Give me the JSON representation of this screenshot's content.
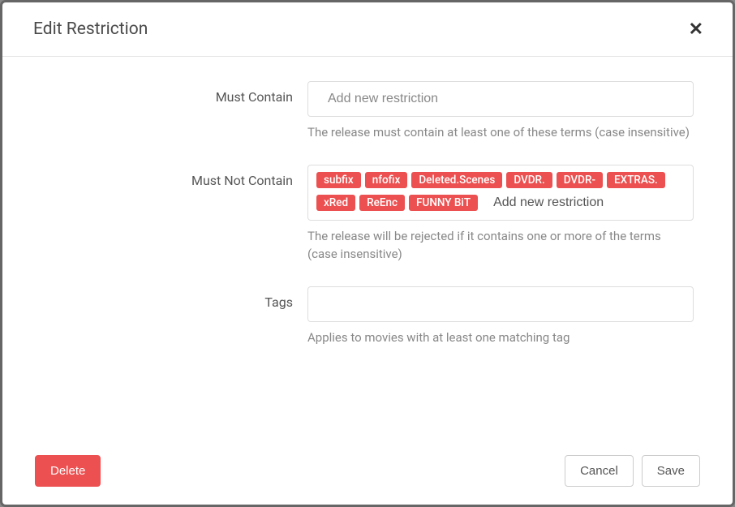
{
  "header": {
    "title": "Edit Restriction"
  },
  "form": {
    "mustContain": {
      "label": "Must Contain",
      "placeholder": "Add new restriction",
      "help": "The release must contain at least one of these terms (case insensitive)",
      "tags": []
    },
    "mustNotContain": {
      "label": "Must Not Contain",
      "placeholder": "Add new restriction",
      "help": "The release will be rejected if it contains one or more of the terms (case insensitive)",
      "tags": [
        "subfix",
        "nfofix",
        "Deleted.Scenes",
        "DVDR.",
        "DVDR-",
        "EXTRAS.",
        "xRed",
        "ReEnc",
        "FUNNY BiT"
      ]
    },
    "tags": {
      "label": "Tags",
      "placeholder": "",
      "help": "Applies to movies with at least one matching tag",
      "tags": []
    }
  },
  "footer": {
    "delete": "Delete",
    "cancel": "Cancel",
    "save": "Save"
  }
}
